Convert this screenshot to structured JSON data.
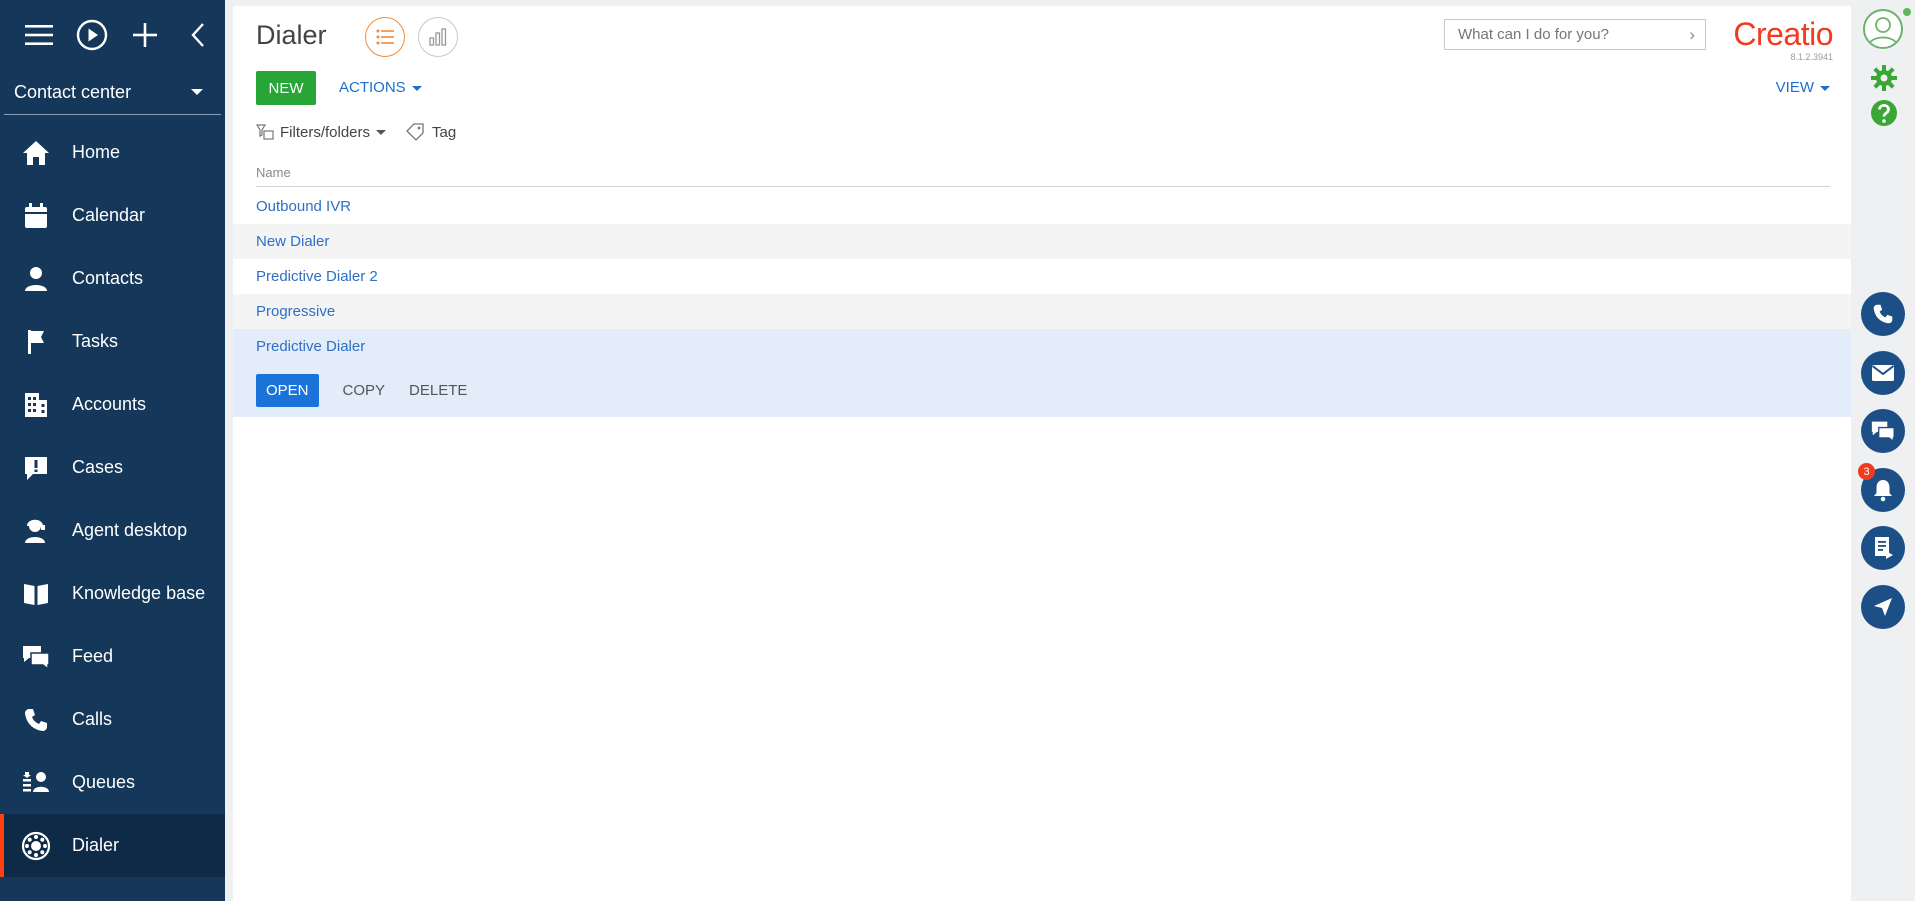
{
  "sidebar": {
    "workplace": "Contact center",
    "items": [
      {
        "label": "Home",
        "icon": "home-icon"
      },
      {
        "label": "Calendar",
        "icon": "calendar-icon"
      },
      {
        "label": "Contacts",
        "icon": "person-icon"
      },
      {
        "label": "Tasks",
        "icon": "flag-icon"
      },
      {
        "label": "Accounts",
        "icon": "building-icon"
      },
      {
        "label": "Cases",
        "icon": "case-icon"
      },
      {
        "label": "Agent desktop",
        "icon": "agent-icon"
      },
      {
        "label": "Knowledge base",
        "icon": "book-icon"
      },
      {
        "label": "Feed",
        "icon": "feed-icon"
      },
      {
        "label": "Calls",
        "icon": "phone-icon"
      },
      {
        "label": "Queues",
        "icon": "queue-icon"
      },
      {
        "label": "Dialer",
        "icon": "dialer-icon",
        "active": true
      }
    ]
  },
  "header": {
    "title": "Dialer",
    "search_placeholder": "What can I do for you?",
    "brand": "Creatio",
    "version": "8.1.2.3941"
  },
  "toolbar": {
    "new_label": "NEW",
    "actions_label": "ACTIONS",
    "view_label": "VIEW",
    "filters_label": "Filters/folders",
    "tag_label": "Tag"
  },
  "list": {
    "column_name": "Name",
    "rows": [
      "Outbound IVR",
      "New Dialer",
      "Predictive Dialer 2",
      "Progressive",
      "Predictive Dialer"
    ],
    "selected_actions": {
      "open": "OPEN",
      "copy": "COPY",
      "delete": "DELETE"
    }
  },
  "right_panel": {
    "notification_count": "3"
  },
  "colors": {
    "sidebar_bg": "#14375a",
    "accent": "#ff4013",
    "new_button": "#27a537",
    "link": "#2f6fc4",
    "open_button": "#1a73d9"
  }
}
